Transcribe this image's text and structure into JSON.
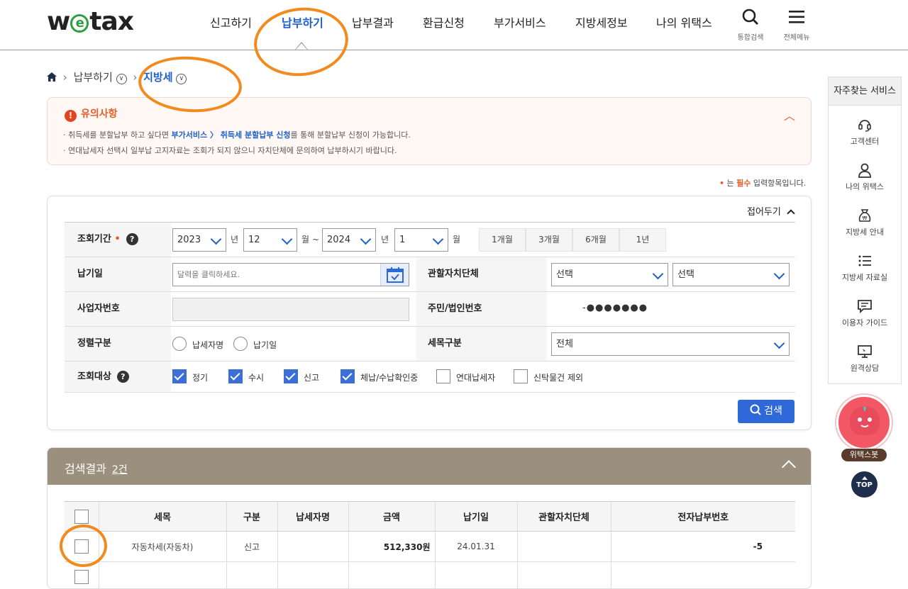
{
  "header": {
    "logo": {
      "w": "w",
      "e": "e",
      "tax": "tax"
    },
    "nav": [
      "신고하기",
      "납부하기",
      "납부결과",
      "환급신청",
      "부가서비스",
      "지방세정보",
      "나의 위택스"
    ],
    "active_nav": "납부하기",
    "search_label": "통합검색",
    "menu_label": "전체메뉴"
  },
  "breadcrumb": {
    "level1": "납부하기",
    "level2": "지방세"
  },
  "notice": {
    "title": "유의사항",
    "line1_pre": "· 취득세를 분할납부 하고 싶다면 ",
    "line1_link": "부가서비스 〉 취득세 분할납부 신청",
    "line1_post": "를 통해 분할납부 신청이 가능합니다.",
    "line2": "· 연대납세자 선택시 일부납 고지자료는 조회가 되지 않으니 자치단체에 문의하여 납부하시기 바랍니다."
  },
  "required_note": {
    "dot": "•",
    "pre": " 는 ",
    "req": "필수",
    "post": " 입력항목입니다."
  },
  "form": {
    "collapse_label": "접어두기",
    "period_label": "조회기간",
    "period_dot": "•",
    "from_year": "2023",
    "from_month": "12",
    "to_year": "2024",
    "to_month": "1",
    "unit_year": "년",
    "unit_month_range": "월 ~",
    "unit_month": "월",
    "period_buttons": [
      "1개월",
      "3개월",
      "6개월",
      "1년"
    ],
    "due_label": "납기일",
    "due_placeholder": "달력을 클릭하세요.",
    "jurisdiction_label": "관할자치단체",
    "jurisdiction_select1": "선택",
    "jurisdiction_select2": "선택",
    "bizno_label": "사업자번호",
    "idno_label": "주민/법인번호",
    "idno_value": "-●●●●●●●",
    "sort_label": "정렬구분",
    "sort_options": [
      "납세자명",
      "납기일"
    ],
    "taxitem_label": "세목구분",
    "taxitem_value": "전체",
    "target_label": "조회대상",
    "targets": [
      {
        "label": "정기",
        "checked": true
      },
      {
        "label": "수시",
        "checked": true
      },
      {
        "label": "신고",
        "checked": true
      },
      {
        "label": "체납/수납확인중",
        "checked": true
      },
      {
        "label": "연대납세자",
        "checked": false
      },
      {
        "label": "신탁물건 제외",
        "checked": false
      }
    ],
    "search_button": "검색"
  },
  "results": {
    "title": "검색결과",
    "count": "2건",
    "columns": [
      "세목",
      "구분",
      "납세자명",
      "금액",
      "납기일",
      "관할자치단체",
      "전자납부번호"
    ],
    "rows": [
      {
        "item": "자동차세(자동차)",
        "type": "신고",
        "name": "",
        "amount": "512,330원",
        "due": "24.01.31",
        "jur": "",
        "epay": "-5"
      }
    ]
  },
  "quick": {
    "title": "자주찾는 서비스",
    "items": [
      "고객센터",
      "나의 위택스",
      "지방세 안내",
      "지방세 자료실",
      "이용자 가이드",
      "원격상담"
    ]
  },
  "bot_label": "위택스봇",
  "top_label": "TOP",
  "colors": {
    "accent": "#1f5fc8",
    "notice": "#e55c25",
    "results_bar": "#9b8f7e",
    "annotation": "#f28a1e"
  }
}
